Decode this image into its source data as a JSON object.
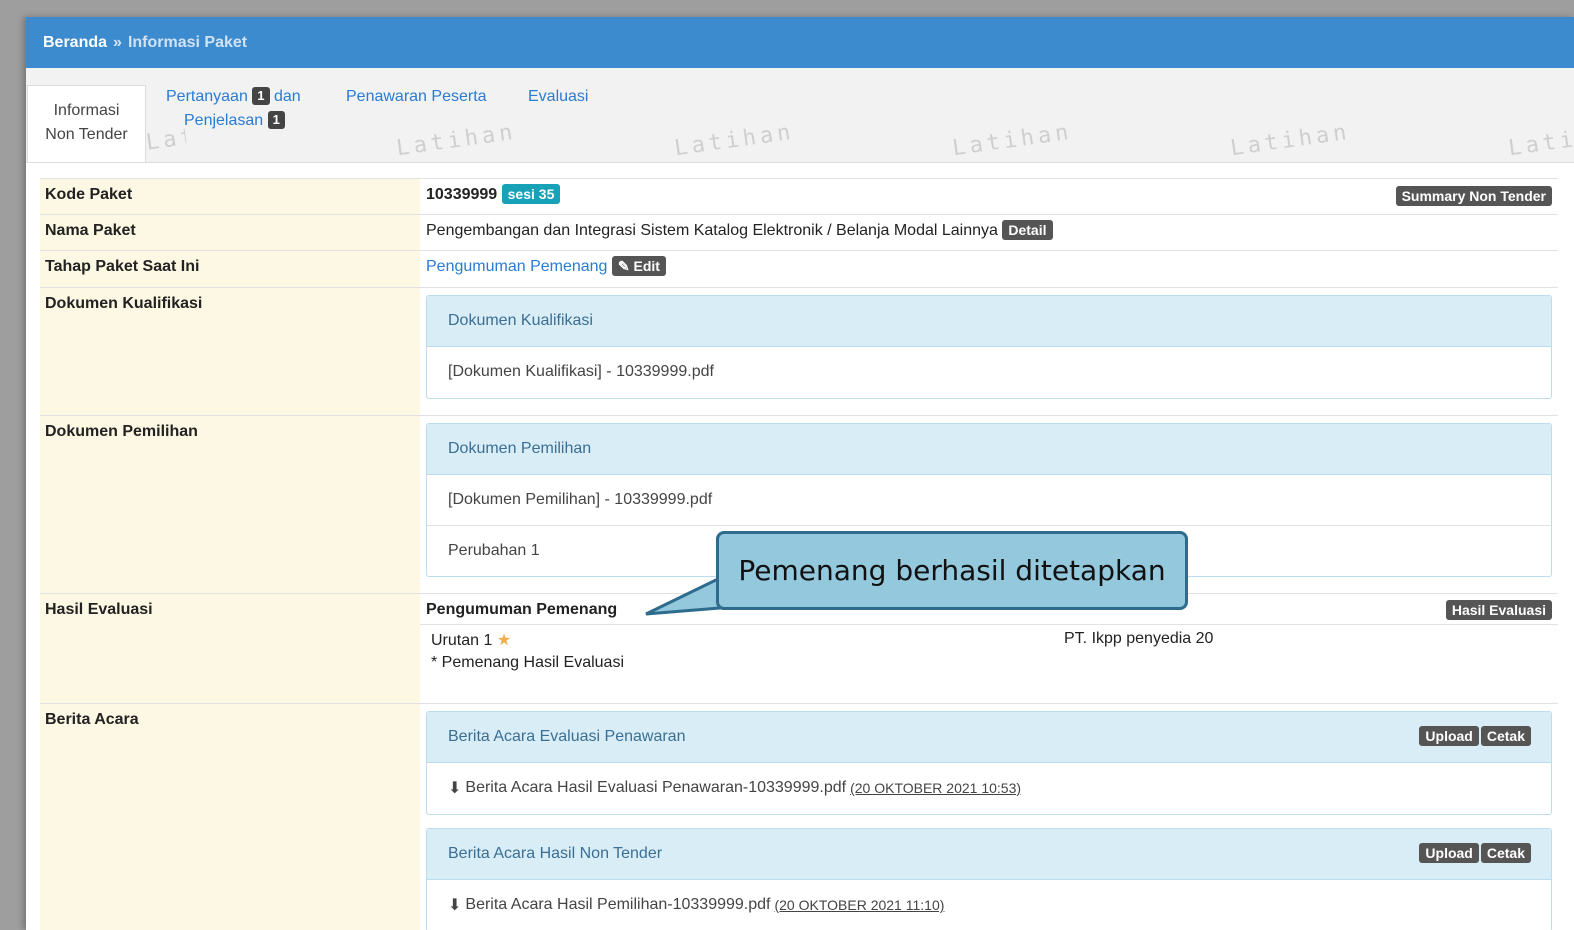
{
  "breadcrumb": {
    "home": "Beranda",
    "separator": "»",
    "current": "Informasi Paket"
  },
  "tabs": [
    {
      "line1": "Informasi",
      "line2": "Non Tender"
    },
    {
      "label_a": "Pertanyaan",
      "badge_a": "1",
      "label_b": "dan",
      "label_c": "Penjelasan",
      "badge_c": "1"
    },
    {
      "label": "Penawaran Peserta"
    },
    {
      "label": "Evaluasi"
    }
  ],
  "watermark": "Latihan",
  "rows": {
    "kode": {
      "label": "Kode Paket",
      "value": "10339999",
      "badge": "sesi 35",
      "button": "Summary Non Tender"
    },
    "nama": {
      "label": "Nama Paket",
      "value": "Pengembangan dan Integrasi Sistem Katalog Elektronik / Belanja Modal Lainnya",
      "button": "Detail"
    },
    "tahap": {
      "label": "Tahap Paket Saat Ini",
      "value": "Pengumuman Pemenang",
      "button": "Edit"
    },
    "kualifikasi": {
      "label": "Dokumen Kualifikasi",
      "panel_title": "Dokumen Kualifikasi",
      "items": [
        "[Dokumen Kualifikasi] - 10339999.pdf"
      ]
    },
    "pemilihan": {
      "label": "Dokumen Pemilihan",
      "panel_title": "Dokumen Pemilihan",
      "items": [
        "[Dokumen Pemilihan] - 10339999.pdf",
        "Perubahan 1"
      ]
    },
    "hasil": {
      "label": "Hasil Evaluasi",
      "title": "Pengumuman Pemenang",
      "button": "Hasil Evaluasi",
      "urutan": "Urutan 1",
      "winner": "PT. Ikpp penyedia 20",
      "note": "* Pemenang Hasil Evaluasi"
    },
    "berita": {
      "label": "Berita Acara",
      "panels": [
        {
          "title": "Berita Acara Evaluasi Penawaran",
          "upload": "Upload",
          "cetak": "Cetak",
          "file": "Berita Acara Hasil Evaluasi Penawaran-10339999.pdf",
          "date": "(20 OKTOBER 2021 10:53)"
        },
        {
          "title": "Berita Acara Hasil Non Tender",
          "upload": "Upload",
          "cetak": "Cetak",
          "file": "Berita Acara Hasil Pemilihan-10339999.pdf",
          "date": "(20 OKTOBER 2021 11:10)"
        }
      ]
    }
  },
  "callout": "Pemenang berhasil ditetapkan"
}
